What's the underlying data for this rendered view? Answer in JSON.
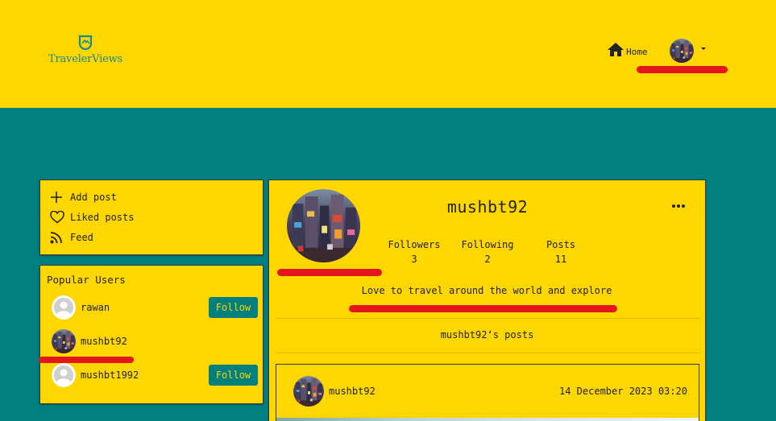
{
  "brand": {
    "name": "TravelerViews"
  },
  "nav": {
    "home_label": "Home",
    "current_user_avatar": "avatar-times-square-photo"
  },
  "sidebar": {
    "menu": [
      {
        "label": "Add post",
        "icon": "plus-icon"
      },
      {
        "label": "Liked posts",
        "icon": "heart-icon"
      },
      {
        "label": "Feed",
        "icon": "rss-icon"
      }
    ],
    "popular": {
      "title": "Popular Users",
      "users": [
        {
          "name": "rawan",
          "avatar": "default-avatar",
          "button": "Follow"
        },
        {
          "name": "mushbt92",
          "avatar": "photo-avatar"
        },
        {
          "name": "mushbt1992",
          "avatar": "default-avatar",
          "button": "Follow"
        }
      ]
    }
  },
  "profile": {
    "username": "mushbt92",
    "stats": [
      {
        "label": "Followers",
        "value": "3"
      },
      {
        "label": "Following",
        "value": "2"
      },
      {
        "label": "Posts",
        "value": "11"
      }
    ],
    "bio": "Love to travel around the world and explore",
    "posts_heading": "mushbt92‘s posts"
  },
  "post": {
    "username": "mushbt92",
    "date": "14 December 2023 03:20"
  },
  "colors": {
    "header_bg": "#ffd700",
    "page_bg": "#027f7f",
    "accent": "#027f7f",
    "redaction": "#e3161c"
  }
}
